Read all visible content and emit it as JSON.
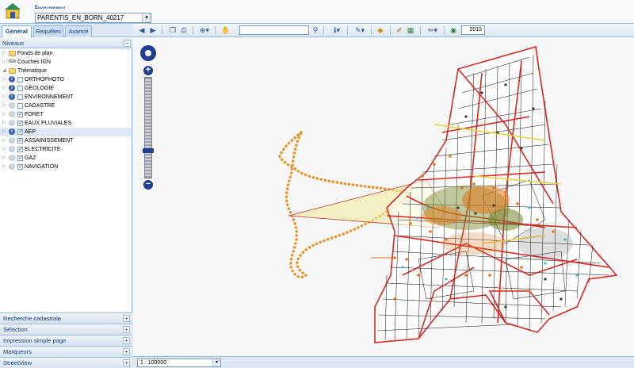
{
  "header": {
    "env_label": "Environnement",
    "env_value": "PARENTIS_EN_BORN_40217"
  },
  "tabs": [
    "Général",
    "Requêtes",
    "Avancé"
  ],
  "levels_title": "Niveaux",
  "layers": [
    {
      "label": "Fonds de plan",
      "kind": "folder"
    },
    {
      "label": "Couches IGN",
      "kind": "ign"
    },
    {
      "label": "Thématique",
      "kind": "folder"
    },
    {
      "label": "ORTHOPHOTO",
      "kind": "layer",
      "checked": false,
      "info_active": true
    },
    {
      "label": "GEOLOGIE",
      "kind": "layer",
      "checked": false,
      "info_active": true
    },
    {
      "label": "ENVIRONNEMENT",
      "kind": "layer",
      "checked": false,
      "info_active": true
    },
    {
      "label": "CADASTRE",
      "kind": "layer",
      "checked": false,
      "info_active": false
    },
    {
      "label": "FORET",
      "kind": "layer",
      "checked": true,
      "info_active": false
    },
    {
      "label": "EAUX PLUVIALES",
      "kind": "layer",
      "checked": true,
      "info_active": false
    },
    {
      "label": "AEP",
      "kind": "layer",
      "checked": true,
      "info_active": true,
      "selected": true
    },
    {
      "label": "ASSAINISSEMENT",
      "kind": "layer",
      "checked": true,
      "info_active": false
    },
    {
      "label": "ELECTRICITE",
      "kind": "layer",
      "checked": true,
      "info_active": false
    },
    {
      "label": "GAZ",
      "kind": "layer",
      "checked": true,
      "info_active": false
    },
    {
      "label": "NAVIGATION",
      "kind": "layer",
      "checked": true,
      "info_active": false
    }
  ],
  "bottom_sections": [
    "Recherche cadastrale",
    "Sélection",
    "Impression simple page",
    "Marqueurs",
    "StreetView"
  ],
  "toolbar": {
    "search_value": "",
    "year": "2015",
    "icons": [
      "back-icon",
      "forward-icon",
      "copy-icon",
      "print-icon",
      "zoom-icon",
      "pan-hand-icon",
      "search-icon",
      "info-icon",
      "measure-icon",
      "warning-icon",
      "layers-icon",
      "draw-icon",
      "photo-icon"
    ]
  },
  "status": {
    "scale": "1 : 100000"
  },
  "colors": {
    "accent": "#15428b",
    "roads": "#d42a22",
    "parcels": "#111111",
    "network": "#e0771a",
    "zone_fill": "#f2e69a"
  }
}
